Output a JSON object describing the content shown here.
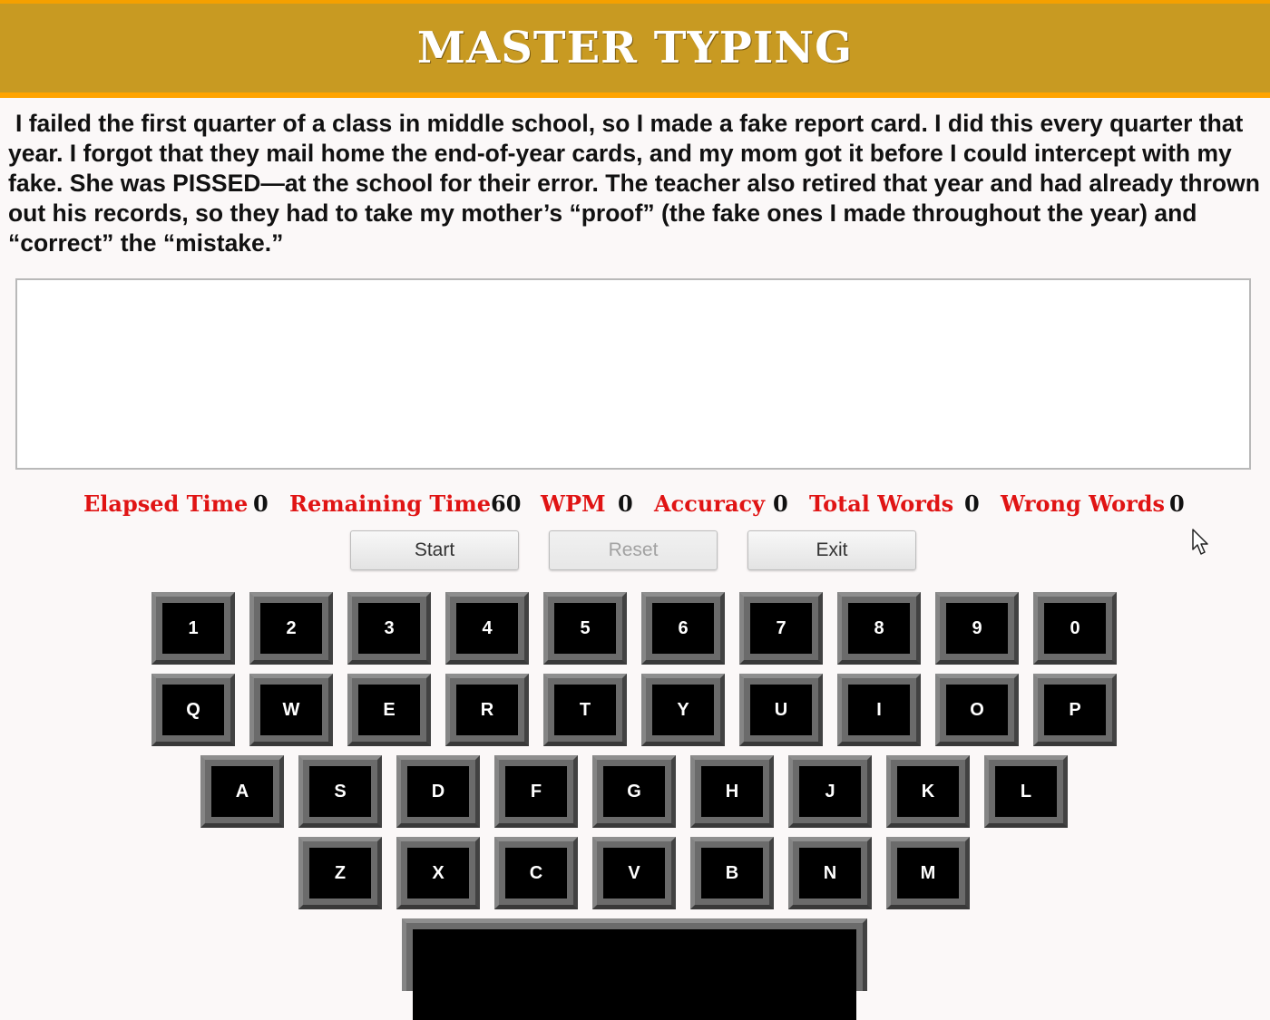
{
  "header": {
    "title": "MASTER TYPING"
  },
  "passage": {
    "text": "I failed the first quarter of a class in middle school, so I made a fake report card. I did this every quarter that year. I forgot that they mail home the end-of-year cards, and my mom got it before I could intercept with my fake. She was PISSED—at the school for their error. The teacher also retired that year and had already thrown out his records, so they had to take my mother’s “proof” (the fake ones I made throughout the year) and “correct” the “mistake.”"
  },
  "input": {
    "value": "",
    "placeholder": ""
  },
  "stats": {
    "elapsed_label": "Elapsed Time",
    "elapsed_value": "0",
    "remaining_label": "Remaining Time",
    "remaining_value": "60",
    "wpm_label": "WPM",
    "wpm_value": "0",
    "accuracy_label": "Accuracy",
    "accuracy_value": "0",
    "total_words_label": "Total Words",
    "total_words_value": "0",
    "wrong_words_label": "Wrong Words",
    "wrong_words_value": "0"
  },
  "buttons": {
    "start": "Start",
    "reset": "Reset",
    "exit": "Exit"
  },
  "keyboard": {
    "row1": [
      "1",
      "2",
      "3",
      "4",
      "5",
      "6",
      "7",
      "8",
      "9",
      "0"
    ],
    "row2": [
      "Q",
      "W",
      "E",
      "R",
      "T",
      "Y",
      "U",
      "I",
      "O",
      "P"
    ],
    "row3": [
      "A",
      "S",
      "D",
      "F",
      "G",
      "H",
      "J",
      "K",
      "L"
    ],
    "row4": [
      "Z",
      "X",
      "C",
      "V",
      "B",
      "N",
      "M"
    ],
    "space": ""
  },
  "colors": {
    "header_bg": "#c89a22",
    "header_border": "#ffa400",
    "stat_label": "#e01414",
    "key_face": "#000000",
    "key_frame": "#6b6b6b"
  }
}
